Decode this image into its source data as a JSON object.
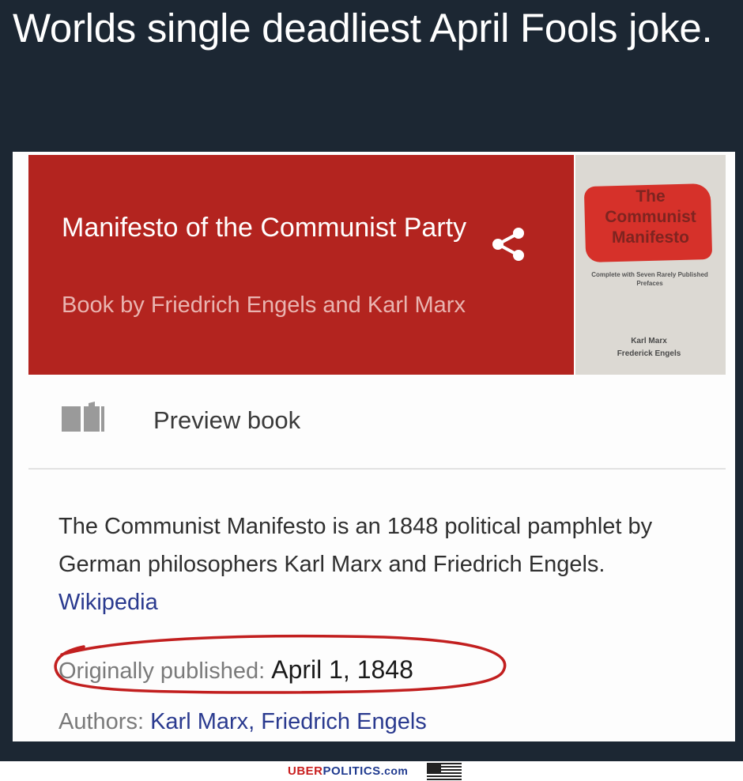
{
  "post": {
    "text": "Worlds single deadliest April Fools joke."
  },
  "card": {
    "title": "Manifesto of the Communist Party",
    "subtitle": "Book by Friedrich Engels and Karl Marx",
    "share_icon": "share-icon",
    "cover": {
      "title_line1": "The",
      "title_line2": "Communist",
      "title_line3": "Manifesto",
      "note": "Complete with Seven Rarely Published Prefaces",
      "author1": "Karl Marx",
      "author2": "Frederick Engels"
    },
    "preview": {
      "icon": "open-book-icon",
      "label": "Preview book"
    },
    "description": {
      "text": "The Communist Manifesto is an 1848 political pamphlet by German philosophers Karl Marx and Friedrich Engels.",
      "source": "Wikipedia"
    },
    "facts": {
      "published_label": "Originally published:",
      "published_value": "April 1, 1848",
      "authors_label": "Authors:",
      "authors_value": "Karl Marx, Friedrich Engels"
    },
    "colors": {
      "header_red": "#b3241f",
      "link_blue": "#2a3a8f",
      "annotation_red": "#c21f1f"
    }
  },
  "watermark": {
    "part1": "UBER",
    "part2": "POLITICS",
    "part3": ".com",
    "flag_icon": "us-flag-icon"
  }
}
